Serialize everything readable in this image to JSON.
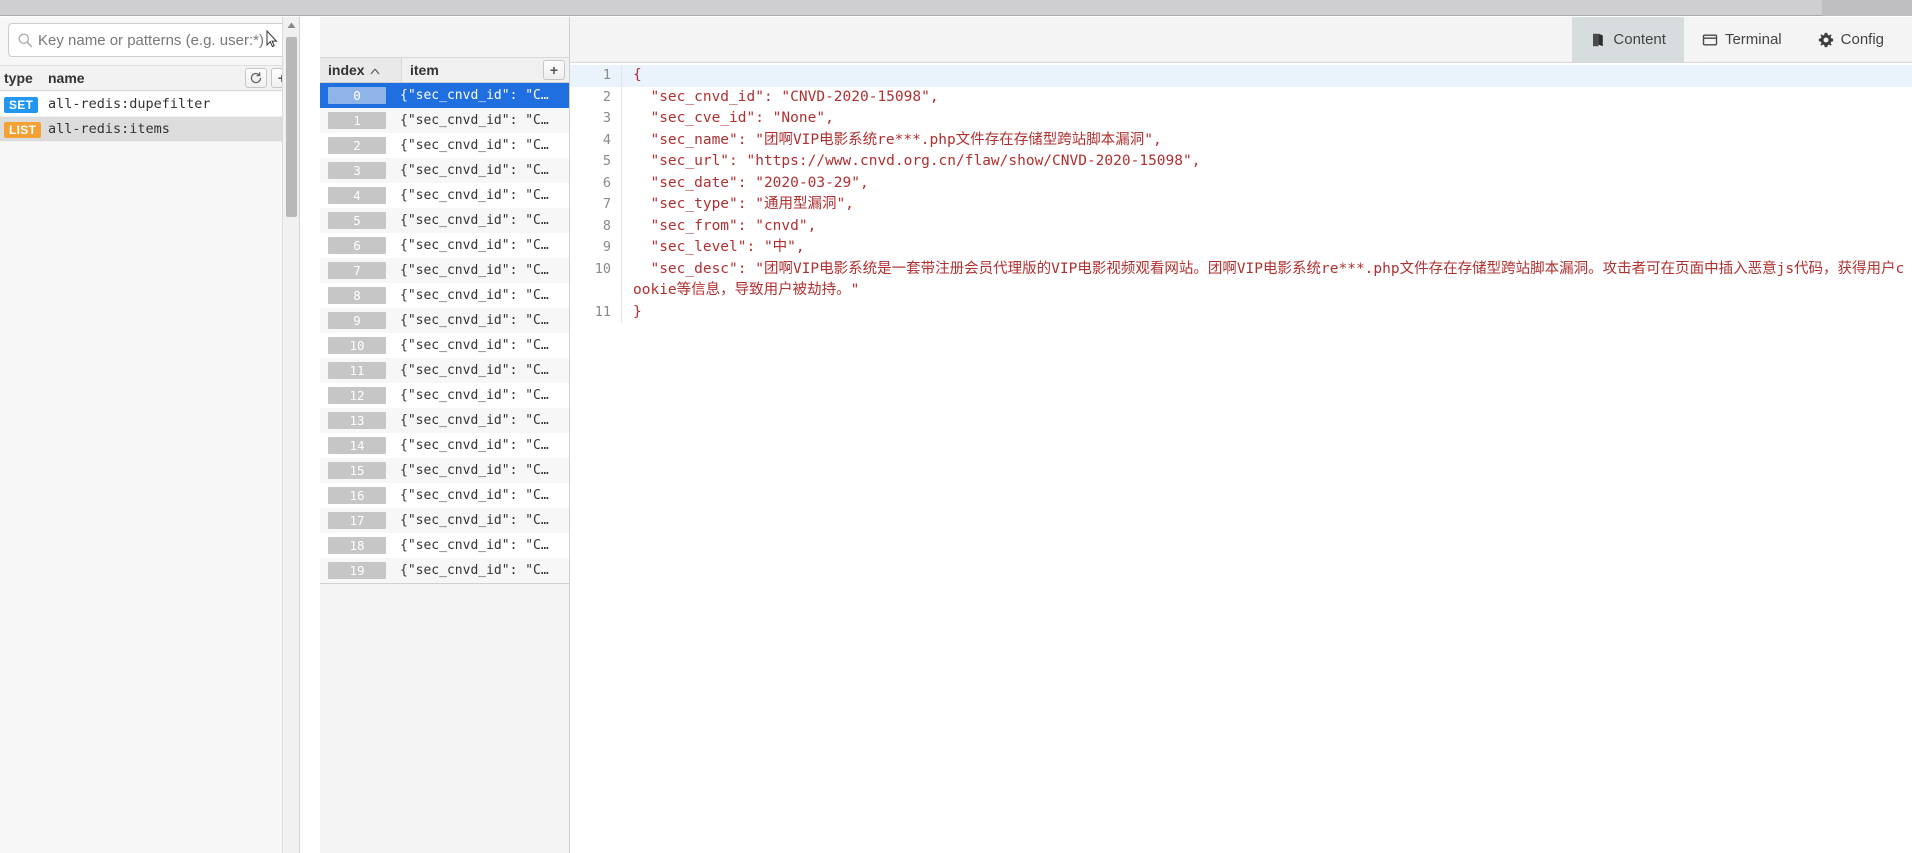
{
  "window": {
    "title_bar_color": "#cfcfd2"
  },
  "keys_panel": {
    "search": {
      "placeholder": "Key name or patterns (e.g. user:*)",
      "value": "",
      "icon": "search-icon"
    },
    "header": {
      "type_label": "type",
      "name_label": "name",
      "refresh_icon": "refresh-icon",
      "add_label": "+"
    },
    "rows": [
      {
        "type": "SET",
        "type_color": "#2196f3",
        "name": "all-redis:dupefilter",
        "selected": false
      },
      {
        "type": "LIST",
        "type_color": "#f5a033",
        "name": "all-redis:items",
        "selected": true
      }
    ]
  },
  "items_panel": {
    "header": {
      "index_label": "index",
      "sort_icon": "sort-ascending-icon",
      "item_label": "item",
      "add_label": "+"
    },
    "rows": [
      {
        "index": "0",
        "preview": "{\"sec_cnvd_id\": \"C…",
        "selected": true
      },
      {
        "index": "1",
        "preview": "{\"sec_cnvd_id\": \"C…",
        "selected": false
      },
      {
        "index": "2",
        "preview": "{\"sec_cnvd_id\": \"C…",
        "selected": false
      },
      {
        "index": "3",
        "preview": "{\"sec_cnvd_id\": \"C…",
        "selected": false
      },
      {
        "index": "4",
        "preview": "{\"sec_cnvd_id\": \"C…",
        "selected": false
      },
      {
        "index": "5",
        "preview": "{\"sec_cnvd_id\": \"C…",
        "selected": false
      },
      {
        "index": "6",
        "preview": "{\"sec_cnvd_id\": \"C…",
        "selected": false
      },
      {
        "index": "7",
        "preview": "{\"sec_cnvd_id\": \"C…",
        "selected": false
      },
      {
        "index": "8",
        "preview": "{\"sec_cnvd_id\": \"C…",
        "selected": false
      },
      {
        "index": "9",
        "preview": "{\"sec_cnvd_id\": \"C…",
        "selected": false
      },
      {
        "index": "10",
        "preview": "{\"sec_cnvd_id\": \"C…",
        "selected": false
      },
      {
        "index": "11",
        "preview": "{\"sec_cnvd_id\": \"C…",
        "selected": false
      },
      {
        "index": "12",
        "preview": "{\"sec_cnvd_id\": \"C…",
        "selected": false
      },
      {
        "index": "13",
        "preview": "{\"sec_cnvd_id\": \"C…",
        "selected": false
      },
      {
        "index": "14",
        "preview": "{\"sec_cnvd_id\": \"C…",
        "selected": false
      },
      {
        "index": "15",
        "preview": "{\"sec_cnvd_id\": \"C…",
        "selected": false
      },
      {
        "index": "16",
        "preview": "{\"sec_cnvd_id\": \"C…",
        "selected": false
      },
      {
        "index": "17",
        "preview": "{\"sec_cnvd_id\": \"C…",
        "selected": false
      },
      {
        "index": "18",
        "preview": "{\"sec_cnvd_id\": \"C…",
        "selected": false
      },
      {
        "index": "19",
        "preview": "{\"sec_cnvd_id\": \"C…",
        "selected": false
      }
    ]
  },
  "tabs": [
    {
      "label": "Content",
      "icon": "book-icon",
      "active": true
    },
    {
      "label": "Terminal",
      "icon": "terminal-icon",
      "active": false
    },
    {
      "label": "Config",
      "icon": "gear-icon",
      "active": false
    }
  ],
  "editor": {
    "active_line": 1,
    "lines": [
      {
        "no": "1",
        "text": "{"
      },
      {
        "no": "2",
        "text": "  \"sec_cnvd_id\": \"CNVD-2020-15098\","
      },
      {
        "no": "3",
        "text": "  \"sec_cve_id\": \"None\","
      },
      {
        "no": "4",
        "text": "  \"sec_name\": \"团啊VIP电影系统re***.php文件存在存储型跨站脚本漏洞\","
      },
      {
        "no": "5",
        "text": "  \"sec_url\": \"https://www.cnvd.org.cn/flaw/show/CNVD-2020-15098\","
      },
      {
        "no": "6",
        "text": "  \"sec_date\": \"2020-03-29\","
      },
      {
        "no": "7",
        "text": "  \"sec_type\": \"通用型漏洞\","
      },
      {
        "no": "8",
        "text": "  \"sec_from\": \"cnvd\","
      },
      {
        "no": "9",
        "text": "  \"sec_level\": \"中\","
      },
      {
        "no": "10",
        "text": "  \"sec_desc\": \"团啊VIP电影系统是一套带注册会员代理版的VIP电影视频观看网站。团啊VIP电影系统re***.php文件存在存储型跨站脚本漏洞。攻击者可在页面中插入恶意js代码，获得用户cookie等信息，导致用户被劫持。\""
      },
      {
        "no": "11",
        "text": "}"
      }
    ],
    "colors": {
      "token": "#b03030",
      "line_number": "#8a8a8a",
      "active_line_bg": "#eaf2fb"
    }
  }
}
